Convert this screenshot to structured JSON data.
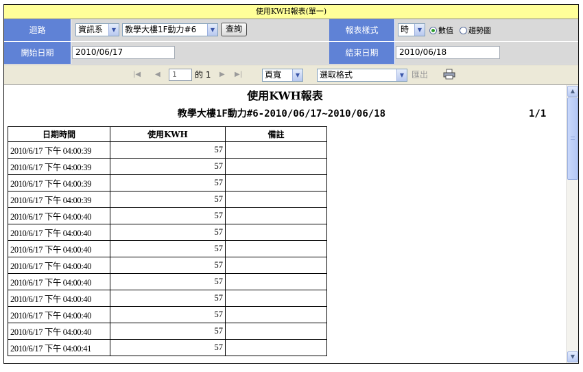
{
  "window_title": "使用KWH報表(單一)",
  "filters": {
    "circuit_label": "迴路",
    "department_value": "資訊系",
    "meter_value": "教學大樓1F動力#6",
    "query_button": "查詢",
    "report_style_label": "報表樣式",
    "interval_value": "時",
    "radio_numeric_label": "數值",
    "radio_trend_label": "趨勢圖",
    "start_date_label": "開始日期",
    "start_date_value": "2010/06/17",
    "end_date_label": "結束日期",
    "end_date_value": "2010/06/18"
  },
  "toolbar": {
    "page_input_value": "1",
    "page_of_text": "的 1",
    "zoom_value": "頁寬",
    "export_format_value": "選取格式",
    "export_label": "匯出"
  },
  "report": {
    "title": "使用KWH報表",
    "subtitle": "教學大樓1F動力#6-2010/06/17~2010/06/18",
    "page_indicator": "1/1",
    "columns": [
      "日期時間",
      "使用KWH",
      "備註"
    ],
    "rows": [
      {
        "datetime": "2010/6/17 下午 04:00:39",
        "kwh": "57",
        "note": ""
      },
      {
        "datetime": "2010/6/17 下午 04:00:39",
        "kwh": "57",
        "note": ""
      },
      {
        "datetime": "2010/6/17 下午 04:00:39",
        "kwh": "57",
        "note": ""
      },
      {
        "datetime": "2010/6/17 下午 04:00:39",
        "kwh": "57",
        "note": ""
      },
      {
        "datetime": "2010/6/17 下午 04:00:40",
        "kwh": "57",
        "note": ""
      },
      {
        "datetime": "2010/6/17 下午 04:00:40",
        "kwh": "57",
        "note": ""
      },
      {
        "datetime": "2010/6/17 下午 04:00:40",
        "kwh": "57",
        "note": ""
      },
      {
        "datetime": "2010/6/17 下午 04:00:40",
        "kwh": "57",
        "note": ""
      },
      {
        "datetime": "2010/6/17 下午 04:00:40",
        "kwh": "57",
        "note": ""
      },
      {
        "datetime": "2010/6/17 下午 04:00:40",
        "kwh": "57",
        "note": ""
      },
      {
        "datetime": "2010/6/17 下午 04:00:40",
        "kwh": "57",
        "note": ""
      },
      {
        "datetime": "2010/6/17 下午 04:00:40",
        "kwh": "57",
        "note": ""
      },
      {
        "datetime": "2010/6/17 下午 04:00:41",
        "kwh": "57",
        "note": ""
      }
    ]
  },
  "colors": {
    "title_bar": "#ffff99",
    "label_cell": "#5f82d6",
    "toolbar_bg": "#ece9d8"
  }
}
